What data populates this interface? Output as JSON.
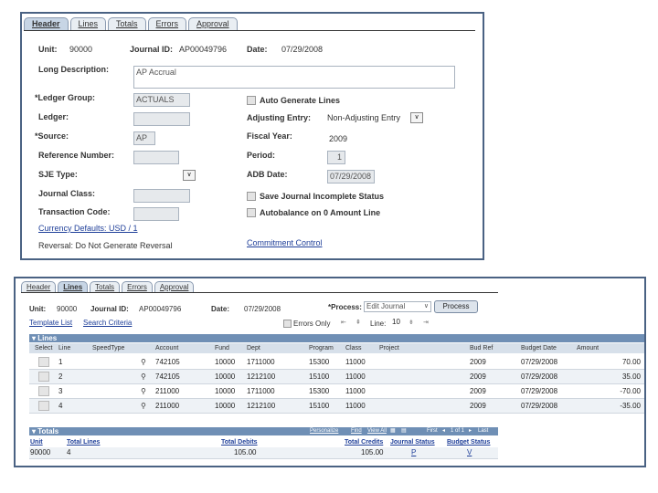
{
  "header_panel": {
    "tabs": [
      "Header",
      "Lines",
      "Totals",
      "Errors",
      "Approval"
    ],
    "unit_label": "Unit:",
    "unit_value": "90000",
    "journal_id_label": "Journal ID:",
    "journal_id_value": "AP00049796",
    "date_label": "Date:",
    "date_value": "07/29/2008",
    "long_desc_label": "Long Description:",
    "long_desc_value": "AP Accrual",
    "ledger_group_label": "*Ledger Group:",
    "ledger_group_value": "ACTUALS",
    "ledger_label": "Ledger:",
    "source_label": "*Source:",
    "source_value": "AP",
    "reference_label": "Reference Number:",
    "sje_label": "SJE Type:",
    "journal_class_label": "Journal Class:",
    "transaction_code_label": "Transaction Code:",
    "currency_link": "Currency Defaults: USD / 1",
    "reversal_text": "Reversal: Do Not Generate Reversal",
    "auto_generate_label": "Auto Generate Lines",
    "adjusting_entry_label": "Adjusting Entry:",
    "adjusting_entry_value": "Non-Adjusting Entry",
    "fiscal_year_label": "Fiscal Year:",
    "fiscal_year_value": "2009",
    "period_label": "Period:",
    "period_value": "1",
    "adb_date_label": "ADB Date:",
    "adb_date_value": "07/29/2008",
    "save_incomplete_label": "Save Journal Incomplete Status",
    "autobalance_label": "Autobalance on 0 Amount Line",
    "commitment_link": "Commitment Control"
  },
  "lines_panel": {
    "tabs": [
      "Header",
      "Lines",
      "Totals",
      "Errors",
      "Approval"
    ],
    "unit_label": "Unit:",
    "unit_value": "90000",
    "journal_id_label": "Journal ID:",
    "journal_id_value": "AP00049796",
    "date_label": "Date:",
    "date_value": "07/29/2008",
    "process_label": "*Process:",
    "process_value": "Edit Journal",
    "process_button": "Process",
    "template_link": "Template List",
    "search_link": "Search Criteria",
    "errors_only_label": "Errors Only",
    "line_label": "Line:",
    "line_value": "10",
    "lines_section_title": "Lines",
    "columns": [
      "Select",
      "Line",
      "SpeedType",
      "Account",
      "Fund",
      "Dept",
      "Program",
      "Class",
      "Project",
      "Bud Ref",
      "Budget Date",
      "Amount"
    ],
    "rows": [
      {
        "line": "1",
        "account": "742105",
        "fund": "10000",
        "dept": "1711000",
        "program": "15300",
        "class": "11000",
        "project": "",
        "budref": "2009",
        "budgetdate": "07/29/2008",
        "amount": "70.00"
      },
      {
        "line": "2",
        "account": "742105",
        "fund": "10000",
        "dept": "1212100",
        "program": "15100",
        "class": "11000",
        "project": "",
        "budref": "2009",
        "budgetdate": "07/29/2008",
        "amount": "35.00"
      },
      {
        "line": "3",
        "account": "211000",
        "fund": "10000",
        "dept": "1711000",
        "program": "15300",
        "class": "11000",
        "project": "",
        "budref": "2009",
        "budgetdate": "07/29/2008",
        "amount": "-70.00"
      },
      {
        "line": "4",
        "account": "211000",
        "fund": "10000",
        "dept": "1212100",
        "program": "15100",
        "class": "11000",
        "project": "",
        "budref": "2009",
        "budgetdate": "07/29/2008",
        "amount": "-35.00"
      }
    ],
    "totals_section_title": "Totals",
    "totals_nav": {
      "personalize": "Personalize",
      "find": "Find",
      "view_all": "View All",
      "first": "First",
      "range": "1 of 1",
      "last": "Last"
    },
    "totals_columns": [
      "Unit",
      "Total Lines",
      "Total Debits",
      "Total Credits",
      "Journal Status",
      "Budget Status"
    ],
    "totals_row": {
      "unit": "90000",
      "total_lines": "4",
      "total_debits": "105.00",
      "total_credits": "105.00",
      "journal_status": "P",
      "budget_status": "V"
    }
  },
  "colors": {
    "panel_border": "#4a6283",
    "grid_header": "#6f8fb5",
    "link": "#1f3f99"
  }
}
